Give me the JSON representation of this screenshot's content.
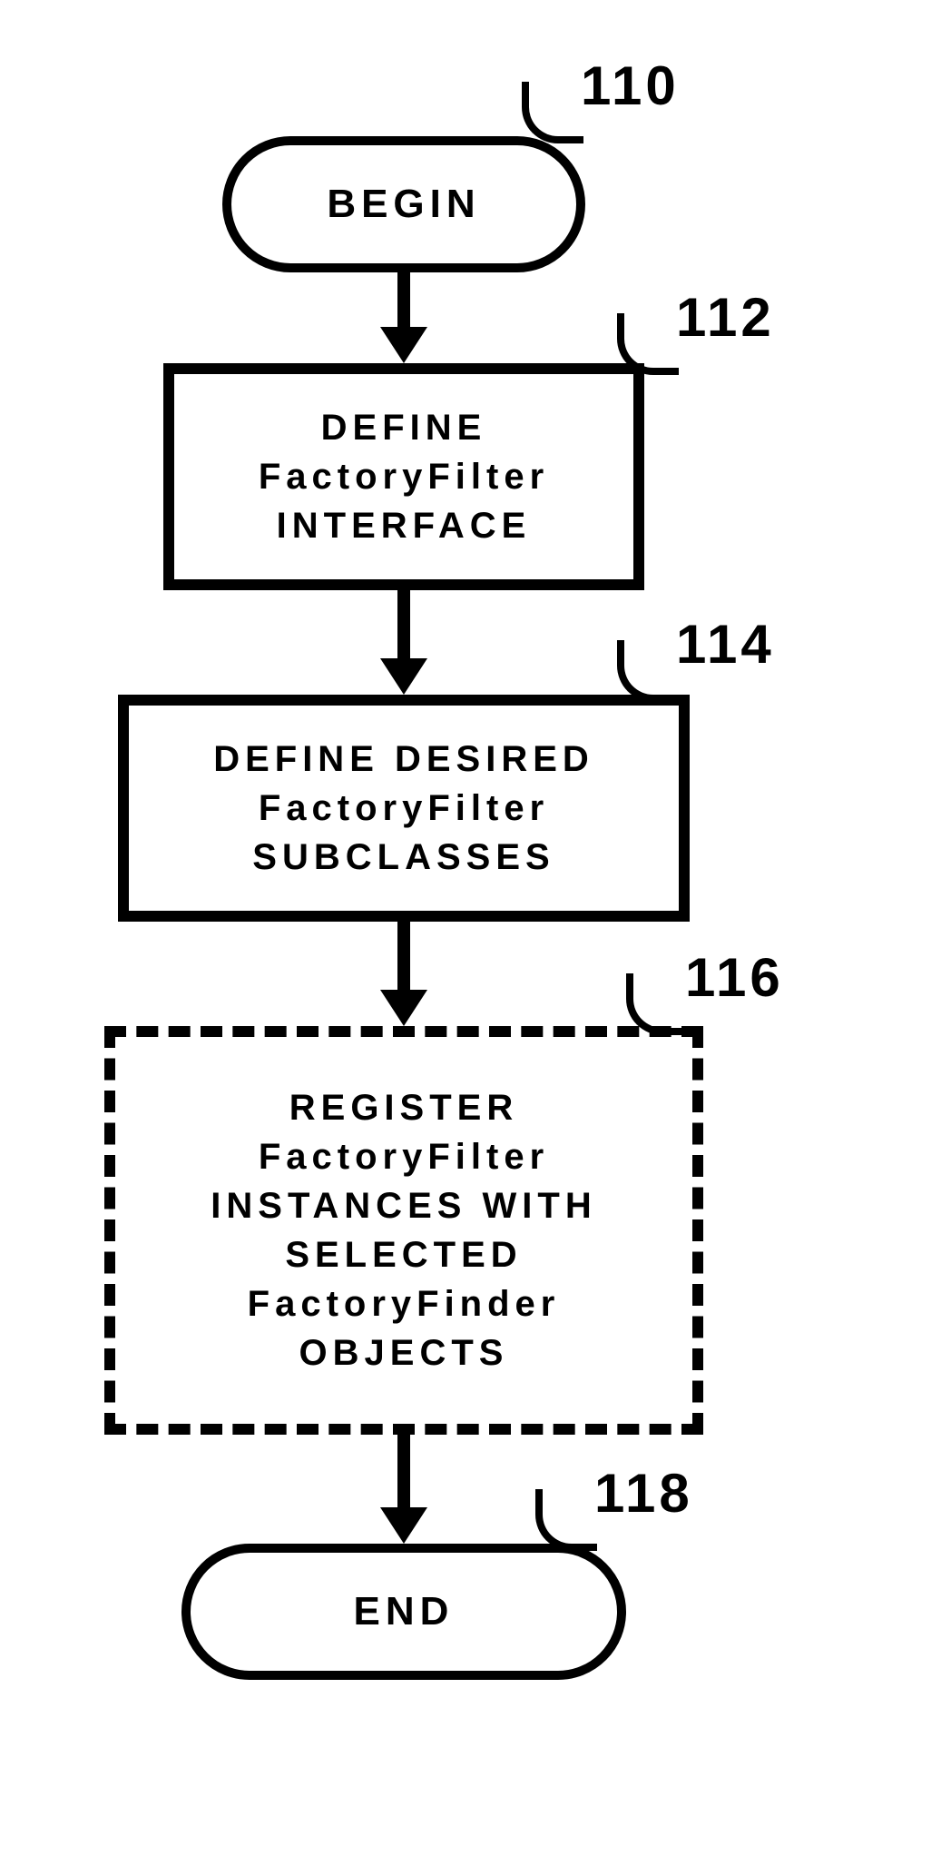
{
  "diagram": {
    "nodes": {
      "begin": {
        "ref": "110",
        "text": "BEGIN"
      },
      "step1": {
        "ref": "112",
        "lines": [
          "DEFINE",
          "FactoryFilter",
          "INTERFACE"
        ]
      },
      "step2": {
        "ref": "114",
        "lines": [
          "DEFINE DESIRED",
          "FactoryFilter",
          "SUBCLASSES"
        ]
      },
      "step3": {
        "ref": "116",
        "lines": [
          "REGISTER",
          "FactoryFilter",
          "INSTANCES WITH",
          "SELECTED",
          "FactoryFinder",
          "OBJECTS"
        ]
      },
      "end": {
        "ref": "118",
        "text": "END"
      }
    }
  }
}
